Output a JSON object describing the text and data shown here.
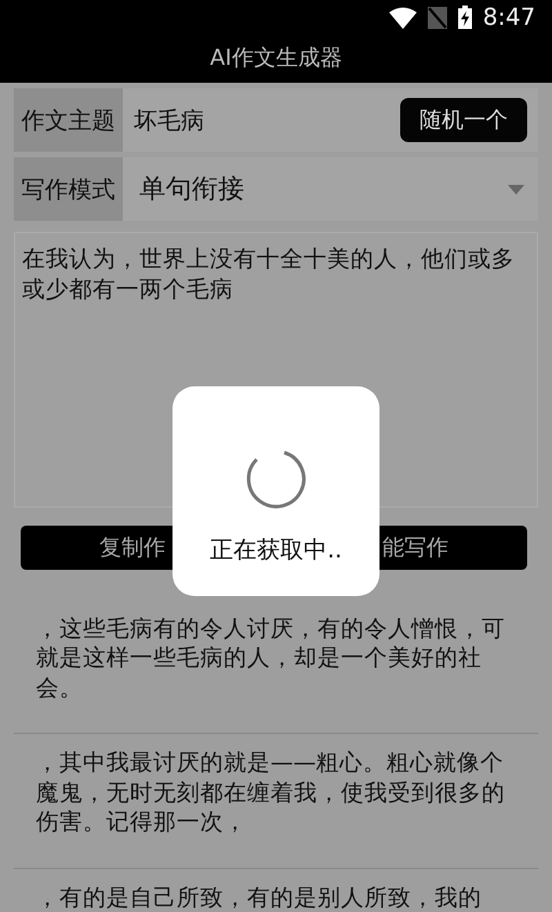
{
  "status_bar": {
    "time": "8:47"
  },
  "app_bar": {
    "title": "AI作文生成器"
  },
  "topic": {
    "label": "作文主题",
    "value": "坏毛病",
    "button": "随机一个"
  },
  "mode": {
    "label": "写作模式",
    "value": "单句衔接"
  },
  "essay": {
    "value": "在我认为，世界上没有十全十美的人，他们或多或少都有一两个毛病"
  },
  "buttons": [
    {
      "label": "复制作"
    },
    {
      "label": "能写作"
    }
  ],
  "sentences": [
    {
      "text": "，这些毛病有的令人讨厌，有的令人憎恨，可就是这样一些毛病的人，却是一个美好的社会。"
    },
    {
      "text": "，其中我最讨厌的就是——粗心。粗心就像个魔鬼，无时无刻都在缠着我，使我受到很多的伤害。记得那一次，"
    },
    {
      "text": "，有的是自己所致，有的是别人所致，我的"
    }
  ],
  "dialog": {
    "message": "正在获取中.."
  }
}
